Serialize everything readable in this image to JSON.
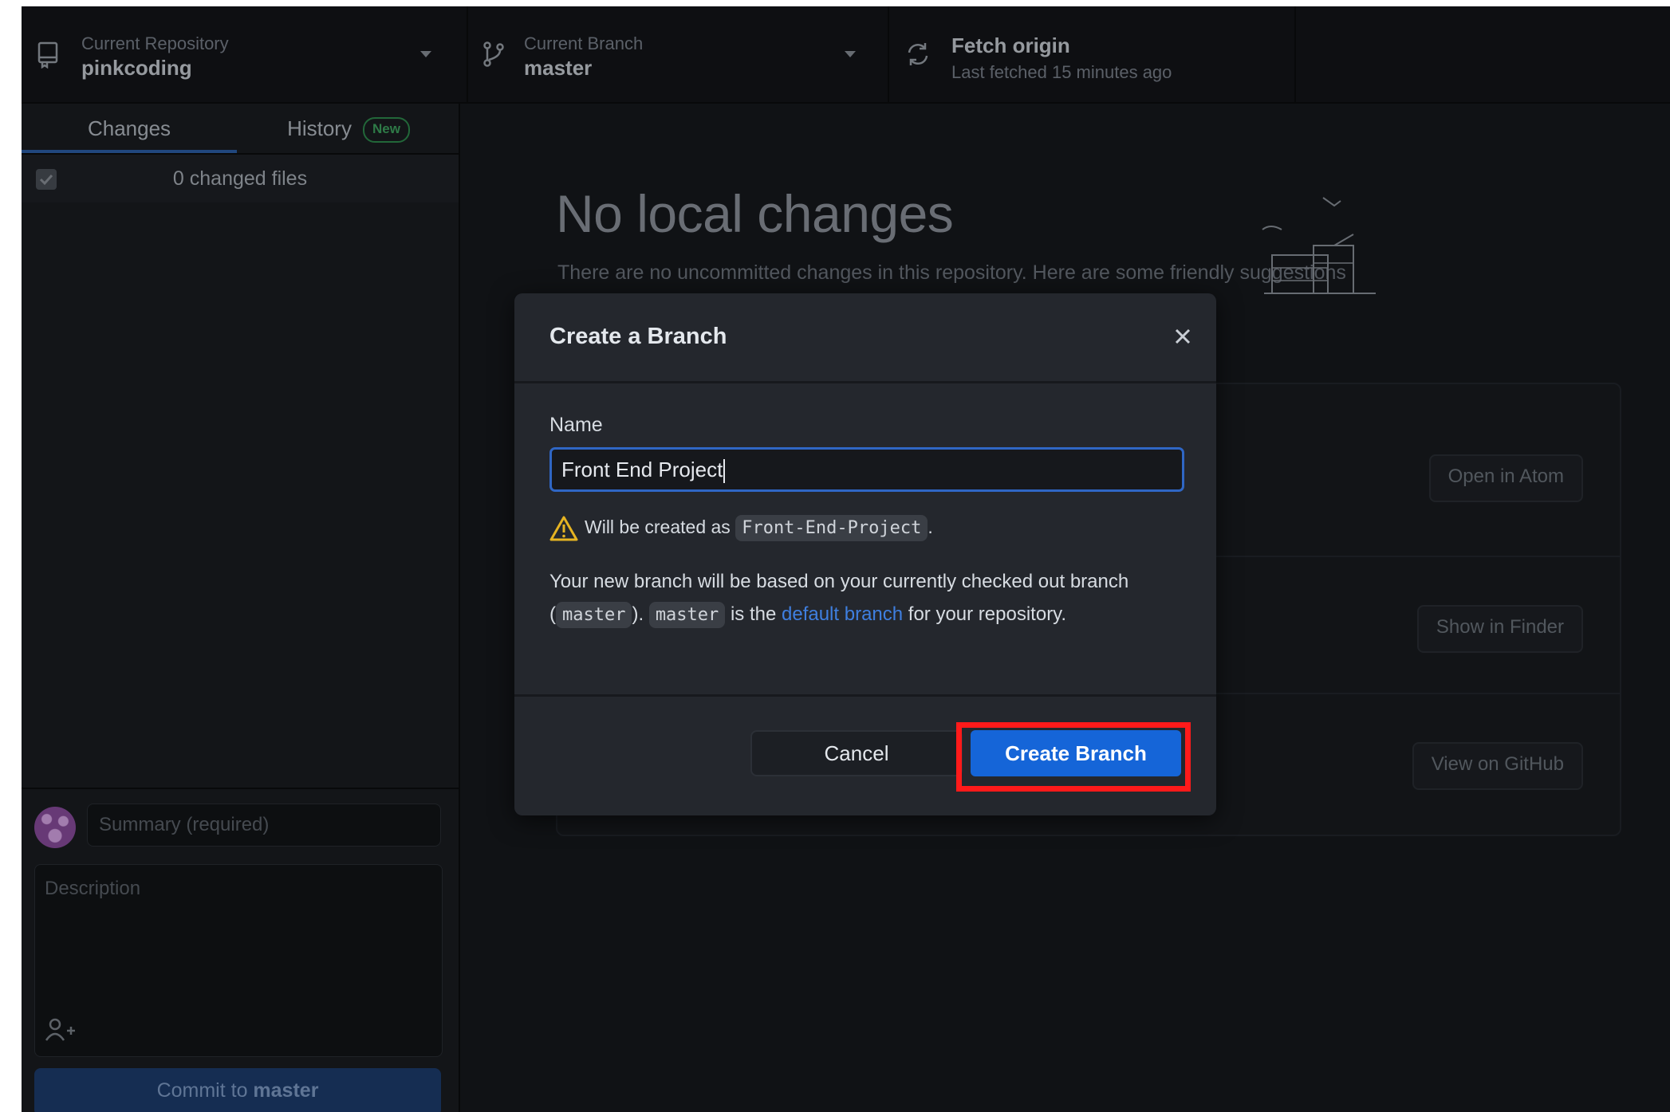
{
  "toolbar": {
    "repository": {
      "label": "Current Repository",
      "value": "pinkcoding"
    },
    "branch": {
      "label": "Current Branch",
      "value": "master"
    },
    "fetch": {
      "label": "Fetch origin",
      "value": "Last fetched 15 minutes ago"
    }
  },
  "sidebar": {
    "tabs": [
      {
        "label": "Changes",
        "active": true
      },
      {
        "label": "History",
        "badge": "New"
      }
    ],
    "changed_files": "0 changed files",
    "summary_placeholder": "Summary (required)",
    "description_placeholder": "Description",
    "commit_button": {
      "prefix": "Commit to ",
      "branch": "master"
    }
  },
  "main": {
    "title": "No local changes",
    "subtitle": "There are no uncommitted changes in this repository. Here are some friendly suggestions",
    "suggestions": [
      {
        "button": "Open in Atom"
      },
      {
        "button": "Show in Finder"
      },
      {
        "button": "View on GitHub"
      }
    ]
  },
  "dialog": {
    "title": "Create a Branch",
    "name_label": "Name",
    "name_value": "Front End Project",
    "warning_prefix": "Will be created as",
    "warning_code": "Front-End-Project",
    "warning_suffix": ".",
    "info": {
      "part1": "Your new branch will be based on your currently checked out branch (",
      "code1": "master",
      "part2": "). ",
      "code2": "master",
      "part3": " is the ",
      "link": "default branch",
      "part4": " for your repository."
    },
    "cancel": "Cancel",
    "create": "Create Branch"
  },
  "colors": {
    "accent": "#1565d8",
    "highlight": "#ff1a1a",
    "link": "#3f7fe0",
    "warning": "#e6b422"
  }
}
